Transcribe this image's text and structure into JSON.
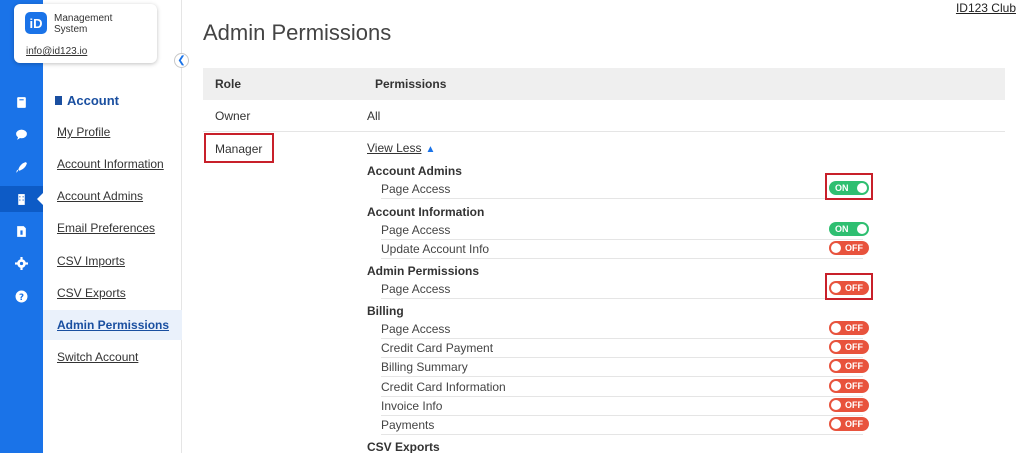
{
  "brand": {
    "logo_text": "iD",
    "name": "Management System",
    "email": "info@id123.io"
  },
  "rail": {
    "icons": [
      "badge-icon",
      "chat-icon",
      "rocket-icon",
      "building-icon",
      "document-icon",
      "gear-icon",
      "help-icon"
    ],
    "active_index": 3
  },
  "sidebar": {
    "section_title": "Account",
    "items": [
      {
        "label": "My Profile"
      },
      {
        "label": "Account Information"
      },
      {
        "label": "Account Admins"
      },
      {
        "label": "Email Preferences"
      },
      {
        "label": "CSV Imports"
      },
      {
        "label": "CSV Exports"
      },
      {
        "label": "Admin Permissions"
      },
      {
        "label": "Switch Account"
      }
    ],
    "active_item": "Admin Permissions"
  },
  "header": {
    "club_link": "ID123 Club",
    "title": "Admin Permissions"
  },
  "table": {
    "col_role": "Role",
    "col_permissions": "Permissions",
    "owner": {
      "role": "Owner",
      "permissions": "All"
    },
    "manager": {
      "role": "Manager",
      "view_less": "View Less"
    }
  },
  "permissions": {
    "account_admins": {
      "title": "Account Admins",
      "rows": [
        {
          "label": "Page Access",
          "state": "ON"
        }
      ]
    },
    "account_information": {
      "title": "Account Information",
      "rows": [
        {
          "label": "Page Access",
          "state": "ON"
        },
        {
          "label": "Update Account Info",
          "state": "OFF"
        }
      ]
    },
    "admin_permissions": {
      "title": "Admin Permissions",
      "rows": [
        {
          "label": "Page Access",
          "state": "OFF"
        }
      ]
    },
    "billing": {
      "title": "Billing",
      "rows": [
        {
          "label": "Page Access",
          "state": "OFF"
        },
        {
          "label": "Credit Card Payment",
          "state": "OFF"
        },
        {
          "label": "Billing Summary",
          "state": "OFF"
        },
        {
          "label": "Credit Card Information",
          "state": "OFF"
        },
        {
          "label": "Invoice Info",
          "state": "OFF"
        },
        {
          "label": "Payments",
          "state": "OFF"
        }
      ]
    },
    "csv_exports": {
      "title": "CSV Exports"
    }
  },
  "colors": {
    "accent": "#1a73e8",
    "on": "#2fbf71",
    "off": "#e8533d",
    "highlight": "#c8202a"
  }
}
